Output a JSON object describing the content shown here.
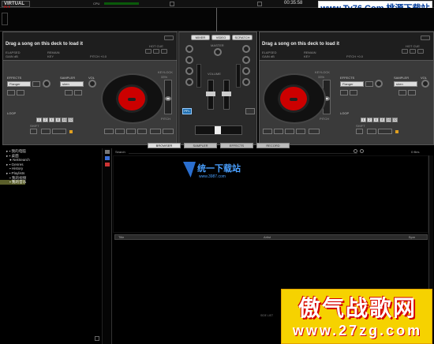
{
  "app": {
    "logo_text": "VIRTUAL",
    "logo_dj": "DJ",
    "cpu_label": "CPU",
    "clock": "00:35:58"
  },
  "watermark_top": "www.Ty76.Com 桃源下载站",
  "deck_left": {
    "title": "Drag a song on this deck to load it",
    "elapsed": "ELAPSED",
    "gain": "GAIN dB",
    "remain": "REMAIN",
    "key": "KEY",
    "pitch": "PITCH +0.0",
    "hotcue": "HOT CUE",
    "effects_label": "EFFECTS",
    "effect_value": "Flanger",
    "sampler_label": "SAMPLER",
    "sampler_value": "siren",
    "vol_label": "VOL",
    "loop_label": "LOOP",
    "shift": "SHIFT",
    "keylock": "KEYLOCK",
    "keylock_pct": "33%",
    "pitch_label": "PITCH",
    "transport": [
      "CUE",
      "PLAY",
      "SYNC"
    ],
    "loop_pads": [
      "1",
      "2",
      "4",
      "8",
      "16",
      "32"
    ],
    "in": "IN",
    "out": "OUT"
  },
  "deck_right": {
    "title": "Drag a song on this deck to load it",
    "elapsed": "ELAPSED",
    "gain": "GAIN dB",
    "remain": "REMAIN",
    "key": "KEY",
    "pitch": "PITCH +0.0",
    "hotcue": "HOT CUE",
    "effects_label": "EFFECTS",
    "effect_value": "Flanger",
    "sampler_label": "SAMPLER",
    "sampler_value": "siren",
    "vol_label": "VOL",
    "loop_label": "LOOP",
    "shift": "SHIFT",
    "keylock": "KEYLOCK",
    "keylock_pct": "33%",
    "pitch_label": "PITCH",
    "transport": [
      "CUE",
      "PLAY",
      "SYNC"
    ],
    "loop_pads": [
      "1",
      "2",
      "4",
      "8",
      "16",
      "32"
    ],
    "in": "IN",
    "out": "OUT"
  },
  "mixer": {
    "tabs": [
      "MIXER",
      "VIDEO",
      "SCRATCH"
    ],
    "master": "MASTER",
    "volume": "VOLUME",
    "gain": "GAIN",
    "high": "HIGH",
    "med": "MED",
    "low": "LOW",
    "pfl": "PFL"
  },
  "browser": {
    "tabs": [
      "BROWSER",
      "SAMPLER",
      "EFFECTS",
      "RECORD"
    ],
    "search_label": "Search",
    "files_label": "0 files",
    "columns": [
      "Title",
      "Artist",
      "Bpm"
    ],
    "sidelist_label": "SIDE LIST",
    "tree": [
      "我的电脑",
      "桌面",
      "NetSearch",
      "Genres",
      "History",
      "Playlists",
      "我的视频",
      "我的音乐"
    ]
  },
  "center_watermark": {
    "line1": "统一下载站",
    "line2": "www.3987.com"
  },
  "banner": {
    "line1": "傲气战歌网",
    "line2": "www.27zg.com"
  }
}
